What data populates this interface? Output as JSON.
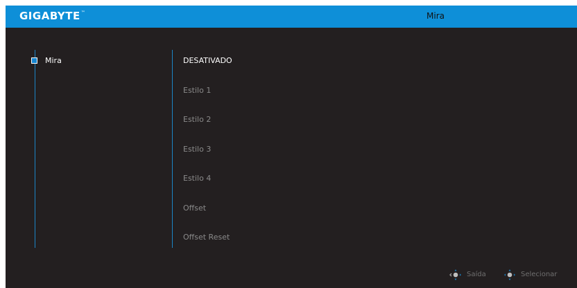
{
  "header": {
    "brand": "GIGABYTE",
    "brand_tm": "™",
    "title": "Mira"
  },
  "sidebar": {
    "items": [
      {
        "label": "Mira",
        "active": true
      }
    ]
  },
  "options": {
    "items": [
      {
        "label": "DESATIVADO",
        "selected": true
      },
      {
        "label": "Estilo 1",
        "selected": false
      },
      {
        "label": "Estilo 2",
        "selected": false
      },
      {
        "label": "Estilo 3",
        "selected": false
      },
      {
        "label": "Estilo 4",
        "selected": false
      },
      {
        "label": "Offset",
        "selected": false
      },
      {
        "label": "Offset Reset",
        "selected": false
      }
    ]
  },
  "footer": {
    "exit_label": "Saída",
    "exit_icon": "joystick-left-icon",
    "select_label": "Selecionar",
    "select_icon": "joystick-press-icon"
  },
  "colors": {
    "accent": "#0e8fd8",
    "background": "#231f20",
    "divider": "#1b86c8",
    "text_active": "#ffffff",
    "text_inactive": "#8a8a8a",
    "hint_text": "#6f6f6f"
  }
}
